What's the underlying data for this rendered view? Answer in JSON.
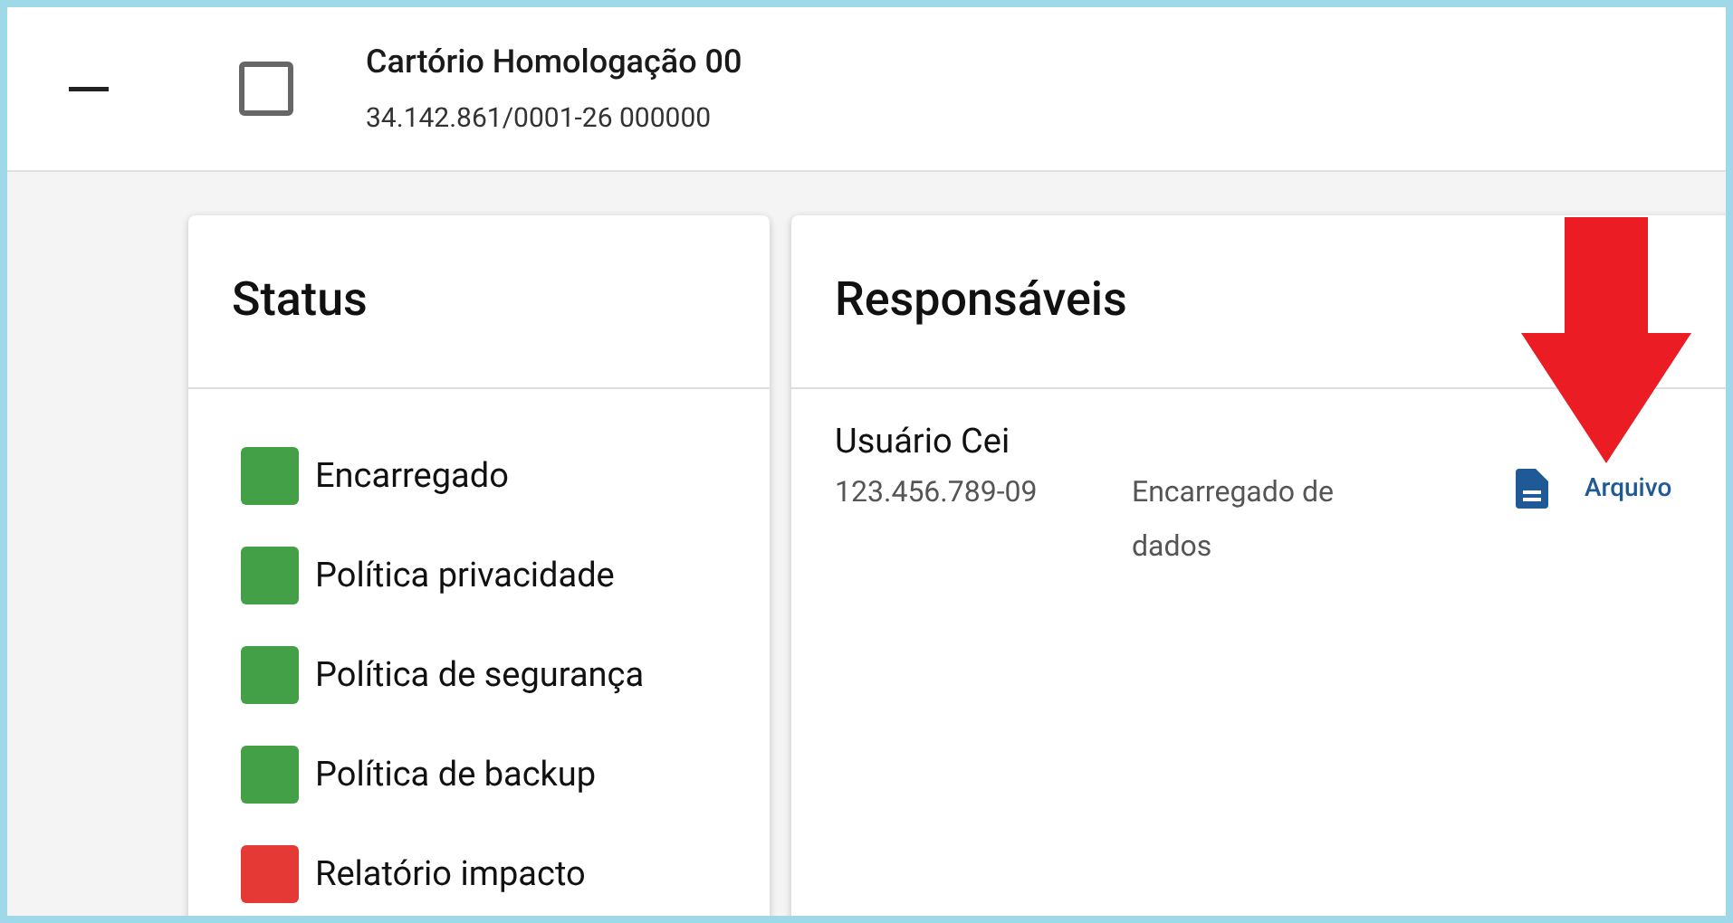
{
  "header": {
    "expanded": true,
    "checked": false,
    "title": "Cartório Homologação 00",
    "subtitle": "34.142.861/0001-26 000000"
  },
  "status": {
    "title": "Status",
    "items": [
      {
        "label": "Encarregado",
        "color": "#43a047"
      },
      {
        "label": "Política privacidade",
        "color": "#43a047"
      },
      {
        "label": "Política de segurança",
        "color": "#43a047"
      },
      {
        "label": "Política de backup",
        "color": "#43a047"
      },
      {
        "label": "Relatório impacto",
        "color": "#e53935"
      }
    ]
  },
  "responsaveis": {
    "title": "Responsáveis",
    "people": [
      {
        "name": "Usuário Cei",
        "document": "123.456.789-09",
        "role": "Encarregado de dados",
        "file_link": "Arquivo"
      }
    ]
  }
}
